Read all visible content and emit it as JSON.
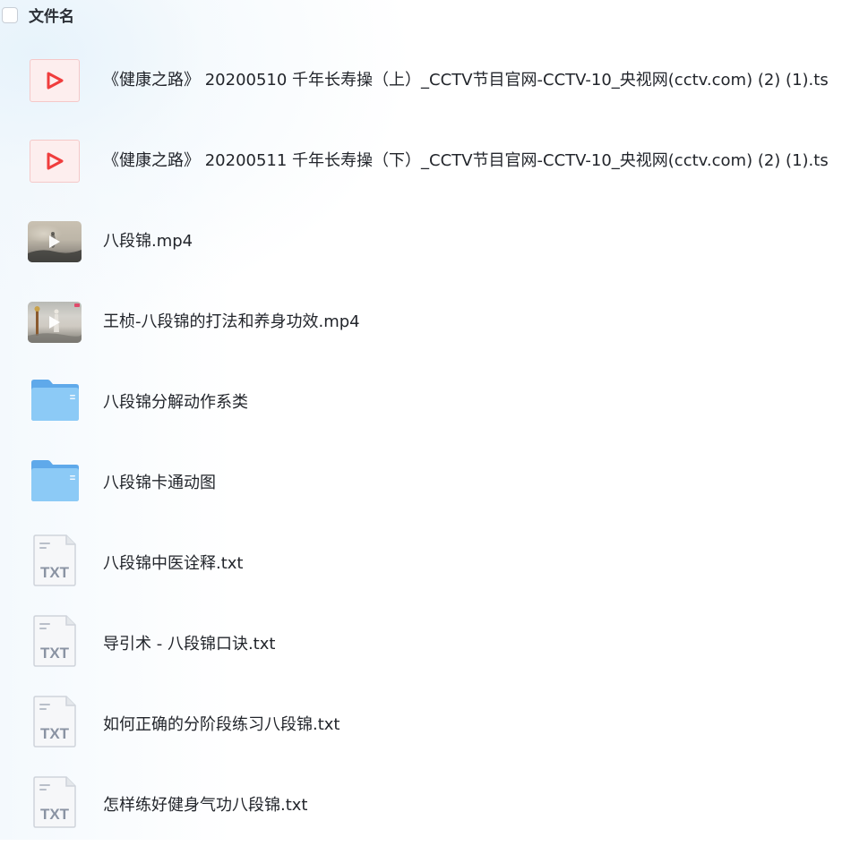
{
  "header": {
    "column_title": "文件名"
  },
  "files": [
    {
      "name": "《健康之路》 20200510 千年长寿操（上）_CCTV节目官网-CCTV-10_央视网(cctv.com) (2) (1).ts",
      "icon": "ts-video-icon"
    },
    {
      "name": "《健康之路》 20200511 千年长寿操（下）_CCTV节目官网-CCTV-10_央视网(cctv.com) (2) (1).ts",
      "icon": "ts-video-icon"
    },
    {
      "name": "八段锦.mp4",
      "icon": "video-thumbnail"
    },
    {
      "name": "王桢-八段锦的打法和养身功效.mp4",
      "icon": "video-thumbnail"
    },
    {
      "name": "八段锦分解动作系类",
      "icon": "folder-icon"
    },
    {
      "name": "八段锦卡通动图",
      "icon": "folder-icon"
    },
    {
      "name": "八段锦中医诠释.txt",
      "icon": "txt-file-icon",
      "icon_label": "TXT"
    },
    {
      "name": "导引术 - 八段锦口诀.txt",
      "icon": "txt-file-icon",
      "icon_label": "TXT"
    },
    {
      "name": "如何正确的分阶段练习八段锦.txt",
      "icon": "txt-file-icon",
      "icon_label": "TXT"
    },
    {
      "name": "怎样练好健身气功八段锦.txt",
      "icon": "txt-file-icon",
      "icon_label": "TXT"
    }
  ],
  "colors": {
    "ts_icon_red": "#f03d3d",
    "folder_blue": "#7cc0f4",
    "txt_gray": "#8a93a3"
  }
}
